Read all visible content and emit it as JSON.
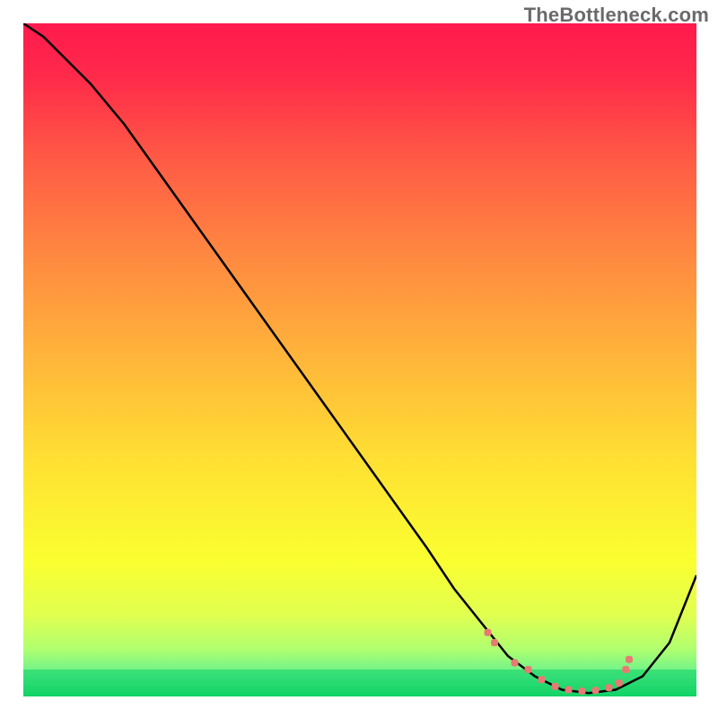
{
  "watermark": "TheBottleneck.com",
  "chart_data": {
    "type": "line",
    "title": "",
    "xlabel": "",
    "ylabel": "",
    "xlim": [
      0,
      100
    ],
    "ylim": [
      0,
      100
    ],
    "grid": false,
    "series": [
      {
        "name": "bottleneck-curve",
        "color": "#000000",
        "stroke_width": 2.5,
        "x": [
          0,
          3,
          6,
          10,
          15,
          20,
          25,
          30,
          35,
          40,
          45,
          50,
          55,
          60,
          64,
          68,
          72,
          76,
          80,
          84,
          88,
          92,
          96,
          100
        ],
        "values": [
          100,
          98,
          95,
          91,
          85,
          78,
          71,
          64,
          57,
          50,
          43,
          36,
          29,
          22,
          16,
          11,
          6,
          3,
          1,
          0.5,
          1,
          3,
          8,
          18
        ]
      },
      {
        "name": "optimal-range-markers",
        "type": "scatter",
        "color": "#e77a73",
        "marker_size": 8,
        "x": [
          69,
          70,
          73,
          75,
          77,
          79,
          81,
          83,
          85,
          87,
          88.5,
          89.5,
          90
        ],
        "values": [
          9.5,
          8,
          5,
          4,
          2.5,
          1.5,
          1,
          0.8,
          0.9,
          1.3,
          2,
          4,
          5.5
        ]
      }
    ],
    "background_gradient": {
      "type": "vertical",
      "stops": [
        {
          "offset": 0.0,
          "color": "#ff1a4d"
        },
        {
          "offset": 0.08,
          "color": "#ff2a4a"
        },
        {
          "offset": 0.2,
          "color": "#ff5a45"
        },
        {
          "offset": 0.35,
          "color": "#ff8a40"
        },
        {
          "offset": 0.5,
          "color": "#ffb63a"
        },
        {
          "offset": 0.65,
          "color": "#ffe033"
        },
        {
          "offset": 0.8,
          "color": "#faff30"
        },
        {
          "offset": 0.88,
          "color": "#e0ff50"
        },
        {
          "offset": 0.93,
          "color": "#b0ff70"
        },
        {
          "offset": 0.97,
          "color": "#60f090"
        },
        {
          "offset": 1.0,
          "color": "#14d66b"
        }
      ]
    },
    "green_band": {
      "y_from": 0,
      "y_to": 4
    }
  }
}
